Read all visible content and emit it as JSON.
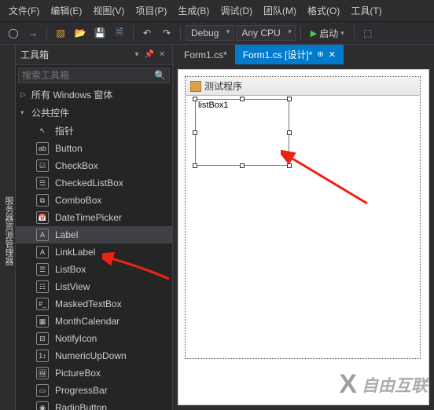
{
  "menu": [
    "文件(F)",
    "编辑(E)",
    "视图(V)",
    "项目(P)",
    "生成(B)",
    "调试(D)",
    "团队(M)",
    "格式(O)",
    "工具(T)"
  ],
  "toolbar": {
    "config": "Debug",
    "platform": "Any CPU",
    "start": "启动"
  },
  "sidetab": "服务器资源管理器",
  "toolbox": {
    "title": "工具箱",
    "search_placeholder": "搜索工具箱",
    "group1": "所有 Windows 窗体",
    "group2": "公共控件",
    "items": [
      {
        "icon": "↖",
        "label": "指针"
      },
      {
        "icon": "ab",
        "label": "Button"
      },
      {
        "icon": "☑",
        "label": "CheckBox"
      },
      {
        "icon": "☲",
        "label": "CheckedListBox"
      },
      {
        "icon": "⧉",
        "label": "ComboBox"
      },
      {
        "icon": "📅",
        "label": "DateTimePicker"
      },
      {
        "icon": "A",
        "label": "Label",
        "selected": true
      },
      {
        "icon": "A",
        "label": "LinkLabel"
      },
      {
        "icon": "☰",
        "label": "ListBox",
        "arrow": true
      },
      {
        "icon": "☷",
        "label": "ListView"
      },
      {
        "icon": "#_",
        "label": "MaskedTextBox"
      },
      {
        "icon": "▦",
        "label": "MonthCalendar"
      },
      {
        "icon": "⊟",
        "label": "NotifyIcon"
      },
      {
        "icon": "1↕",
        "label": "NumericUpDown"
      },
      {
        "icon": "🖼",
        "label": "PictureBox"
      },
      {
        "icon": "▭",
        "label": "ProgressBar"
      },
      {
        "icon": "◉",
        "label": "RadioButton"
      }
    ]
  },
  "tabs": [
    {
      "label": "Form1.cs*",
      "active": false
    },
    {
      "label": "Form1.cs [设计]*",
      "active": true
    }
  ],
  "form": {
    "title": "测试程序",
    "listbox_text": "listBox1"
  },
  "watermark": "自由互联"
}
